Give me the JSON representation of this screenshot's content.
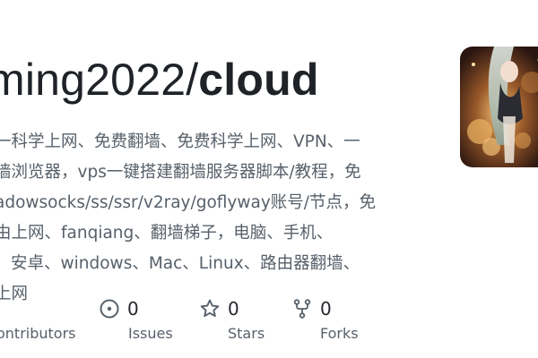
{
  "repo": {
    "owner": "ming2022/",
    "name": "cloud"
  },
  "description": {
    "lines": [
      "一科学上网、免费翻墙、免费科学上网、VPN、一",
      "墙浏览器，vps一键搭建翻墙服务器脚本/教程，免",
      "adowsocks/ss/ssr/v2ray/goflyway账号/节点，免",
      "由上网、fanqiang、翻墙梯子，电脑、手机、",
      "安卓、windows、Mac、Linux、路由器翻墙、",
      "上网"
    ]
  },
  "stats": {
    "contributors": {
      "label": "ontributors"
    },
    "issues": {
      "count": "0",
      "label": "Issues",
      "icon": "issue-opened-icon"
    },
    "stars": {
      "count": "0",
      "label": "Stars",
      "icon": "star-icon"
    },
    "forks": {
      "count": "0",
      "label": "Forks",
      "icon": "repo-forked-icon"
    }
  },
  "colors": {
    "title": "#1f2328",
    "muted": "#57606a",
    "background": "#ffffff"
  }
}
